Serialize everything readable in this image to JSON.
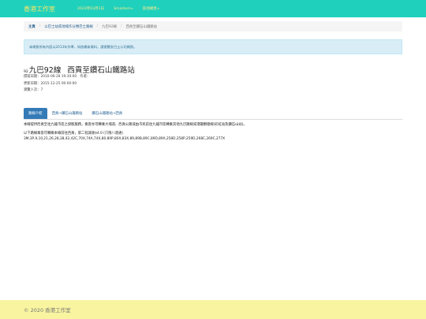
{
  "navbar": {
    "brand": "香港工作室",
    "items": [
      {
        "label": "2023年03月1日"
      },
      {
        "label": "Smiohers"
      },
      {
        "label": "其他網頁"
      }
    ]
  },
  "breadcrumb": [
    "主頁",
    "以巴士站或地域作分類巴士路線",
    "九巴92線",
    "西貢至鑽石山鐵路站"
  ],
  "alert": "本網頁所有內容以2013年作準，如欲最新資料，請瀏覽各巴士公司網頁。",
  "route": {
    "prefix": "92",
    "name": "九巴92線",
    "subtitle": "西貢至鑽石山鐵路站"
  },
  "meta": {
    "created": "撰寫日期：2010-06-28 19:30:00　作者：",
    "updated": "更新日期：2015-12-25 00:00:00",
    "views": "瀏覽人次：7"
  },
  "tabs": [
    {
      "label": "路線介紹",
      "active": true
    },
    {
      "label": "西貢→鑽石山鐵路站"
    },
    {
      "label": "鑽石山鐵路站→西貢"
    }
  ],
  "content": {
    "intro": "本線提供西貢至往九龍市區之接駁服務，乘客亦可轉乘大埔道、西貢公路或由市民前往九龍市區轉乘其他九巴路線或港鐵觀塘線(彩虹站及鑽石山站)。",
    "interchange_label": "以下路線乘客可轉乘本線前往西貢，第二程減收$4.0 (只限八達通)",
    "interchange_routes": "3M,3P,9,10,21,26,28,38,42,42C,70X,74A,74X,80,80P,80X,83X,89,89B,89C,89D,89X,258D,258P,259D,268C,269C,277X"
  },
  "footer": "© 2020 香港工作室"
}
